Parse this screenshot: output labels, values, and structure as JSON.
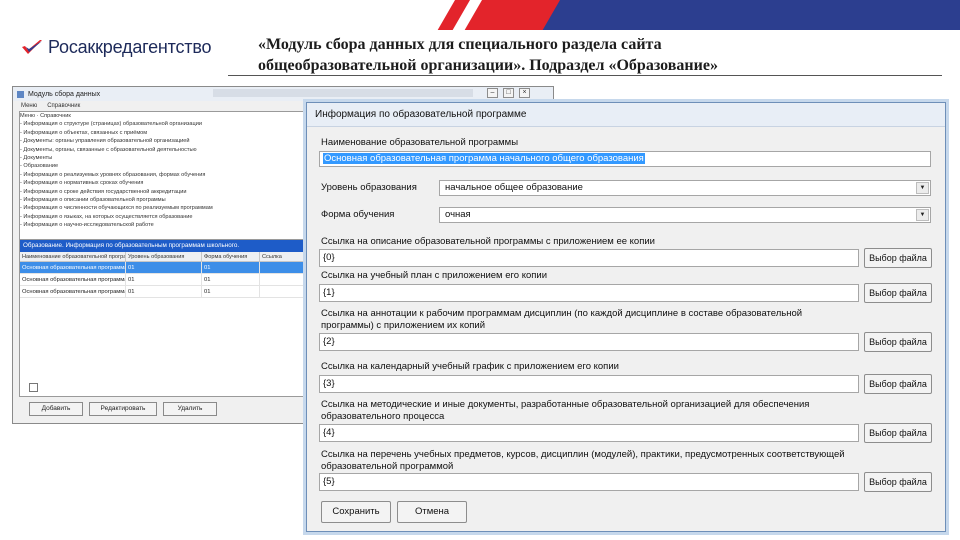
{
  "slide": {
    "logo_text": "Росаккредагентство",
    "title_line1": "«Модуль сбора данных для специального раздела сайта",
    "title_line2": "общеобразовательной организации». Подраздел «Образование»"
  },
  "back_window": {
    "title": "Модуль сбора данных",
    "menu": [
      "Меню",
      "Справочник"
    ],
    "tree": [
      "Меню · Справочник",
      "  - Информация о структуре (страницах) образовательной организации",
      "  - Информация о объектах, связанных с приёмом",
      "  - Документы: органы управления образовательной организацией",
      "  - Документы, органы, связанные с образовательной деятельностью",
      "- Документы",
      "  - Образование",
      "    - Информация о реализуемых уровнях образования, формах обучения",
      "    - Информация о нормативных сроках обучения",
      "    - Информация о сроке действия государственной аккредитации",
      "    - Информация о описании образовательной программы",
      "    - Информация о численности обучающихся по реализуемым программам",
      "    - Информация о языках, на которых осуществляется образование",
      "    - Информация о научно-исследовательской работе"
    ],
    "grid_title": "Образование. Информация по образовательным программам школьного.",
    "grid_columns": [
      "Наименование образовательной программы",
      "Уровень образования",
      "Форма обучения",
      "Ссылка"
    ],
    "grid_rows": [
      [
        "Основная образовательная программа начального общего образования",
        "01",
        "01",
        ""
      ],
      [
        "Основная образовательная программа основного общего образования",
        "01",
        "01",
        ""
      ],
      [
        "Основная образовательная программа среднего общего образования",
        "01",
        "01",
        ""
      ]
    ],
    "buttons": {
      "add": "Добавить",
      "edit": "Редактировать",
      "delete": "Удалить"
    }
  },
  "dialog": {
    "title": "Информация по образовательной программе",
    "name_label": "Наименование образовательной программы",
    "name_value": "Основная образовательная программа начального общего образования",
    "level_label": "Уровень образования",
    "level_value": "начальное общее образование",
    "form_label": "Форма обучения",
    "form_value": "очная",
    "links": [
      {
        "label": "Ссылка на описание образовательной программы с приложением ее копии",
        "value": "{0}"
      },
      {
        "label": "Ссылка на учебный план с приложением его копии",
        "value": "{1}"
      },
      {
        "label": "Ссылка на аннотации к рабочим программам дисциплин (по каждой дисциплине в составе образовательной программы) с приложением их копий",
        "value": "{2}"
      },
      {
        "label": "Ссылка на календарный учебный график с приложением его копии",
        "value": "{3}"
      },
      {
        "label": "Ссылка на методические и иные документы, разработанные образовательной организацией для обеспечения образовательного процесса",
        "value": "{4}"
      },
      {
        "label": "Ссылка на перечень учебных предметов, курсов, дисциплин (модулей), практики, предусмотренных соответствующей образовательной программой",
        "value": "{5}"
      }
    ],
    "pick_file_label": "Выбор файла",
    "save_label": "Сохранить",
    "cancel_label": "Отмена"
  },
  "colors": {
    "brand_red": "#e3242b",
    "brand_blue": "#2c3e8f",
    "selection": "#3399ff"
  }
}
